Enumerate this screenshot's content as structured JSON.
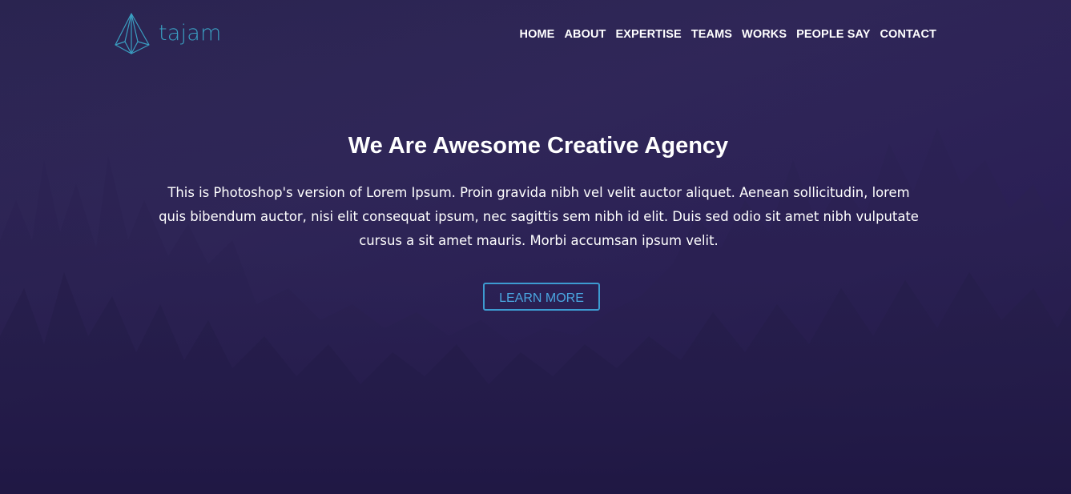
{
  "header": {
    "logo_text": "tajam",
    "logo_icon": "paper-plane-icon",
    "nav": [
      {
        "label": "HOME"
      },
      {
        "label": "ABOUT"
      },
      {
        "label": "EXPERTISE"
      },
      {
        "label": "TEAMS"
      },
      {
        "label": "WORKS"
      },
      {
        "label": "PEOPLE SAY"
      },
      {
        "label": "CONTACT"
      }
    ]
  },
  "hero": {
    "title": "We Are Awesome Creative Agency",
    "text": "This is Photoshop's version of Lorem Ipsum. Proin gravida nibh vel velit auctor aliquet. Aenean sollicitudin, lorem quis bibendum auctor, nisi elit consequat ipsum, nec sagittis sem nibh id elit. Duis sed odio sit amet nibh vulputate cursus a sit amet mauris. Morbi accumsan ipsum velit.",
    "button_label": "LEARN MORE",
    "background_image": "forest-silhouette"
  },
  "colors": {
    "accent": "#3a9fc2",
    "button_border": "#3d9bd1",
    "overlay": "#2f2657",
    "text": "#ffffff"
  }
}
